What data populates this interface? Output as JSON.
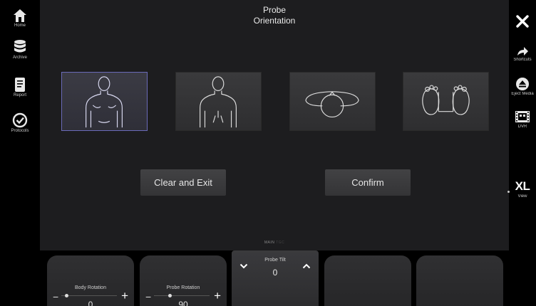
{
  "header": {
    "title_line1": "Probe",
    "title_line2": "Orientation"
  },
  "left_nav": [
    {
      "label": "Home",
      "icon": "home-icon"
    },
    {
      "label": "Archive",
      "icon": "database-icon"
    },
    {
      "label": "Report",
      "icon": "document-icon"
    },
    {
      "label": "Protocols",
      "icon": "checkmark-circle-icon"
    }
  ],
  "right_nav": {
    "close_icon": "close-icon",
    "shortcuts": "Shortcuts",
    "eject": "Eject Media",
    "dvr": "DVR",
    "view_value": "XL",
    "view_label": "View"
  },
  "orientation_options": [
    {
      "name": "body-front",
      "selected": true
    },
    {
      "name": "body-back",
      "selected": false
    },
    {
      "name": "head-top",
      "selected": false
    },
    {
      "name": "feet-sole",
      "selected": false
    }
  ],
  "actions": {
    "clear_exit": "Clear and Exit",
    "confirm": "Confirm"
  },
  "page_indicator": {
    "active": "MAIN",
    "inactive": "TGC"
  },
  "knobs": {
    "body_rotation": {
      "label": "Body Rotation",
      "value": "0",
      "position": 0.06
    },
    "probe_rotation": {
      "label": "Probe Rotation",
      "value": "90",
      "position": 0.25
    },
    "probe_tilt": {
      "label": "Probe Tilt",
      "value": "0"
    }
  },
  "colors": {
    "selected_border": "#6a6ab8",
    "panel": "#1d1d1f",
    "button": "#3a3a3c"
  }
}
